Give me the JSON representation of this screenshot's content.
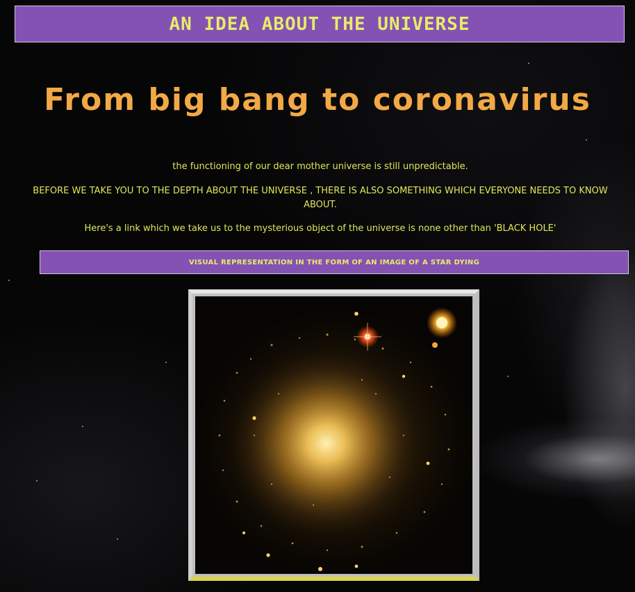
{
  "header": {
    "title": "AN IDEA ABOUT THE UNIVERSE"
  },
  "main": {
    "heading": "From big bang to coronavirus",
    "paragraphs": [
      "the functioning of our dear mother universe is still unpredictable.",
      "BEFORE WE TAKE YOU TO THE DEPTH ABOUT THE UNIVERSE , THERE IS ALSO SOMETHING WHICH EVERYONE NEEDS TO KNOW ABOUT.",
      "Here's a link which we take us to the mysterious object of the universe is none other than 'BLACK HOLE'"
    ],
    "link_button": "VISUAL REPRESENTATION IN THE FORM OF AN IMAGE OF A STAR DYING"
  },
  "colors": {
    "accent_purple": "#8452b3",
    "header_text": "#e6ec6a",
    "heading_orange": "#f2a945",
    "body_text": "#dfe85a",
    "background": "#060607"
  }
}
